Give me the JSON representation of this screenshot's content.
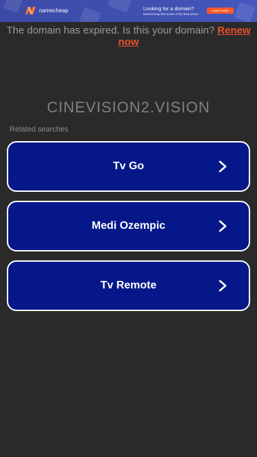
{
  "banner": {
    "brand": "namecheap",
    "headline": "Looking for a domain?",
    "subline": "Namecheap has some of the best prices",
    "cta": "Learn more",
    "colors": {
      "background": "#3e4fae",
      "cta": "#ff5a2b",
      "logo": "#ff7a2b"
    }
  },
  "notice": {
    "text": "The domain has expired. Is this your domain?",
    "link": "Renew now",
    "link_color": "#e8502a"
  },
  "domain": "CINEVISION2.VISION",
  "related_label": "Related searches",
  "searches": [
    {
      "label": "Tv Go",
      "icon": "chevron-right-icon"
    },
    {
      "label": "Medi Ozempic",
      "icon": "chevron-right-icon"
    },
    {
      "label": "Tv Remote",
      "icon": "chevron-right-icon"
    }
  ],
  "colors": {
    "page": "#2a2a2a",
    "button": "#061889",
    "button_border": "#ffffff"
  }
}
